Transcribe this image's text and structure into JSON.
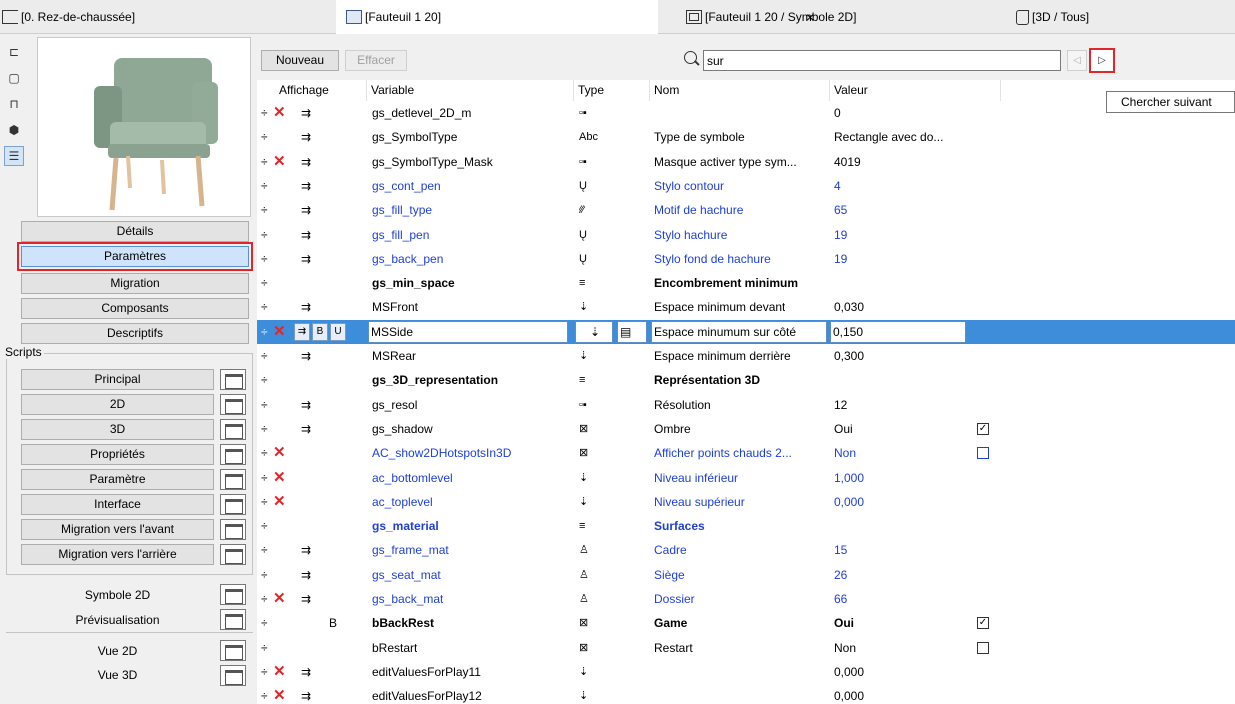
{
  "tabs": [
    {
      "label": "[0. Rez-de-chaussée]",
      "icon": "floorplan-icon"
    },
    {
      "label": "[Fauteuil 1 20]",
      "icon": "object-icon"
    },
    {
      "label": "[Fauteuil 1 20 / Symbole 2D]",
      "icon": "window-icon"
    },
    {
      "label": "[3D / Tous]",
      "icon": "3d-window-icon"
    }
  ],
  "tab_close": "×",
  "left": {
    "main_buttons": [
      "Détails",
      "Paramètres",
      "Migration",
      "Composants",
      "Descriptifs"
    ],
    "scripts_label": "Scripts",
    "script_buttons": [
      "Principal",
      "2D",
      "3D",
      "Propriétés",
      "Paramètre",
      "Interface",
      "Migration vers l'avant",
      "Migration vers l'arrière"
    ],
    "other_labels": [
      "Symbole 2D",
      "Prévisualisation",
      "Vue 2D",
      "Vue 3D"
    ]
  },
  "toolbar": {
    "new_label": "Nouveau",
    "delete_label": "Effacer",
    "search_value": "sur",
    "prev_glyph": "◁",
    "next_glyph": "▷",
    "tooltip": "Chercher suivant"
  },
  "table": {
    "headers": [
      "Affichage",
      "Variable",
      "Type",
      "Nom",
      "Valeur"
    ],
    "rows": [
      {
        "del": true,
        "hide": true,
        "variable": "gs_detlevel_2D_m",
        "type": "▫▪",
        "name": "",
        "value": "0",
        "style": ""
      },
      {
        "del": false,
        "hide": true,
        "variable": "gs_SymbolType",
        "type": "Abc",
        "name": "Type de symbole",
        "value": "Rectangle avec do...",
        "style": ""
      },
      {
        "del": true,
        "hide": true,
        "variable": "gs_SymbolType_Mask",
        "type": "▫▪",
        "name": "Masque activer type sym...",
        "value": "4019",
        "style": ""
      },
      {
        "del": false,
        "hide": true,
        "variable": "gs_cont_pen",
        "type": "Ų",
        "name": "Stylo contour",
        "value": "4",
        "style": "blue"
      },
      {
        "del": false,
        "hide": true,
        "variable": "gs_fill_type",
        "type": "⁄⁄⁄",
        "name": "Motif de hachure",
        "value": "65",
        "style": "blue"
      },
      {
        "del": false,
        "hide": true,
        "variable": "gs_fill_pen",
        "type": "Ų",
        "name": "Stylo hachure",
        "value": "19",
        "style": "blue"
      },
      {
        "del": false,
        "hide": true,
        "variable": "gs_back_pen",
        "type": "Ų",
        "name": "Stylo fond de hachure",
        "value": "19",
        "style": "blue"
      },
      {
        "del": false,
        "hide": false,
        "variable": "gs_min_space",
        "type": "≡",
        "name": "Encombrement minimum",
        "value": "",
        "style": "bold"
      },
      {
        "del": false,
        "hide": true,
        "variable": "MSFront",
        "type": "⇣",
        "name": "Espace minimum devant",
        "value": "0,030",
        "style": ""
      },
      {
        "del": true,
        "hide": true,
        "variable": "MSSide",
        "type": "⇣",
        "name": "Espace minumum sur côté",
        "value": "0,150",
        "style": "selected"
      },
      {
        "del": false,
        "hide": true,
        "variable": "MSRear",
        "type": "⇣",
        "name": "Espace minimum derrière",
        "value": "0,300",
        "style": ""
      },
      {
        "del": false,
        "hide": false,
        "variable": "gs_3D_representation",
        "type": "≡",
        "name": "Représentation 3D",
        "value": "",
        "style": "bold"
      },
      {
        "del": false,
        "hide": true,
        "variable": "gs_resol",
        "type": "▫▪",
        "name": "Résolution",
        "value": "12",
        "style": ""
      },
      {
        "del": false,
        "hide": true,
        "variable": "gs_shadow",
        "type": "⊠",
        "name": "Ombre",
        "value": "Oui",
        "style": "",
        "check": "✓"
      },
      {
        "del": true,
        "hide": false,
        "variable": "AC_show2DHotspotsIn3D",
        "type": "⊠",
        "name": "Afficher points chauds 2...",
        "value": "Non",
        "style": "blue",
        "check": ""
      },
      {
        "del": true,
        "hide": false,
        "variable": "ac_bottomlevel",
        "type": "⇣",
        "name": "Niveau inférieur",
        "value": "1,000",
        "style": "blue"
      },
      {
        "del": true,
        "hide": false,
        "variable": "ac_toplevel",
        "type": "⇣",
        "name": "Niveau supérieur",
        "value": "0,000",
        "style": "blue"
      },
      {
        "del": false,
        "hide": false,
        "variable": "gs_material",
        "type": "≡",
        "name": "Surfaces",
        "value": "",
        "style": "bluebold"
      },
      {
        "del": false,
        "hide": true,
        "variable": "gs_frame_mat",
        "type": "♙",
        "name": "Cadre",
        "value": "15",
        "style": "blue"
      },
      {
        "del": false,
        "hide": true,
        "variable": "gs_seat_mat",
        "type": "♙",
        "name": "Siège",
        "value": "26",
        "style": "blue"
      },
      {
        "del": true,
        "hide": true,
        "variable": "gs_back_mat",
        "type": "♙",
        "name": "Dossier",
        "value": "66",
        "style": "blue"
      },
      {
        "del": false,
        "hide": false,
        "flag": "B",
        "variable": "bBackRest",
        "type": "⊠",
        "name": "Game",
        "value": "Oui",
        "style": "bold",
        "check": "✓"
      },
      {
        "del": false,
        "hide": false,
        "variable": "bRestart",
        "type": "⊠",
        "name": "Restart",
        "value": "Non",
        "style": "",
        "check": ""
      },
      {
        "del": true,
        "hide": true,
        "variable": "editValuesForPlay11",
        "type": "⇣",
        "name": "",
        "value": "0,000",
        "style": ""
      },
      {
        "del": true,
        "hide": true,
        "variable": "editValuesForPlay12",
        "type": "⇣",
        "name": "",
        "value": "0,000",
        "style": ""
      }
    ],
    "row_marker": "÷",
    "del_glyph": "✕",
    "hide_glyph": "⇉",
    "selected_row_tools": [
      "B",
      "U"
    ]
  }
}
